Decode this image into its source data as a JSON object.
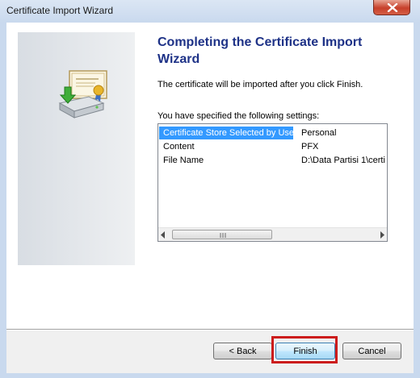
{
  "window": {
    "title": "Certificate Import Wizard",
    "close_icon": "close-icon"
  },
  "page": {
    "heading": "Completing the Certificate Import Wizard",
    "description": "The certificate will be imported after you click Finish.",
    "settings_label": "You have specified the following settings:"
  },
  "settings": {
    "rows": [
      {
        "key": "Certificate Store Selected by User",
        "value": "Personal",
        "selected": true
      },
      {
        "key": "Content",
        "value": "PFX",
        "selected": false
      },
      {
        "key": "File Name",
        "value": "D:\\Data Partisi 1\\certi",
        "selected": false
      }
    ]
  },
  "scrollbar": {
    "left_icon": "scroll-left-icon",
    "right_icon": "scroll-right-icon",
    "grip": "|||"
  },
  "buttons": {
    "back": "< Back",
    "finish": "Finish",
    "cancel": "Cancel"
  },
  "colors": {
    "heading": "#1e3287",
    "selection": "#3399ff",
    "highlight": "#cc1c1c"
  }
}
